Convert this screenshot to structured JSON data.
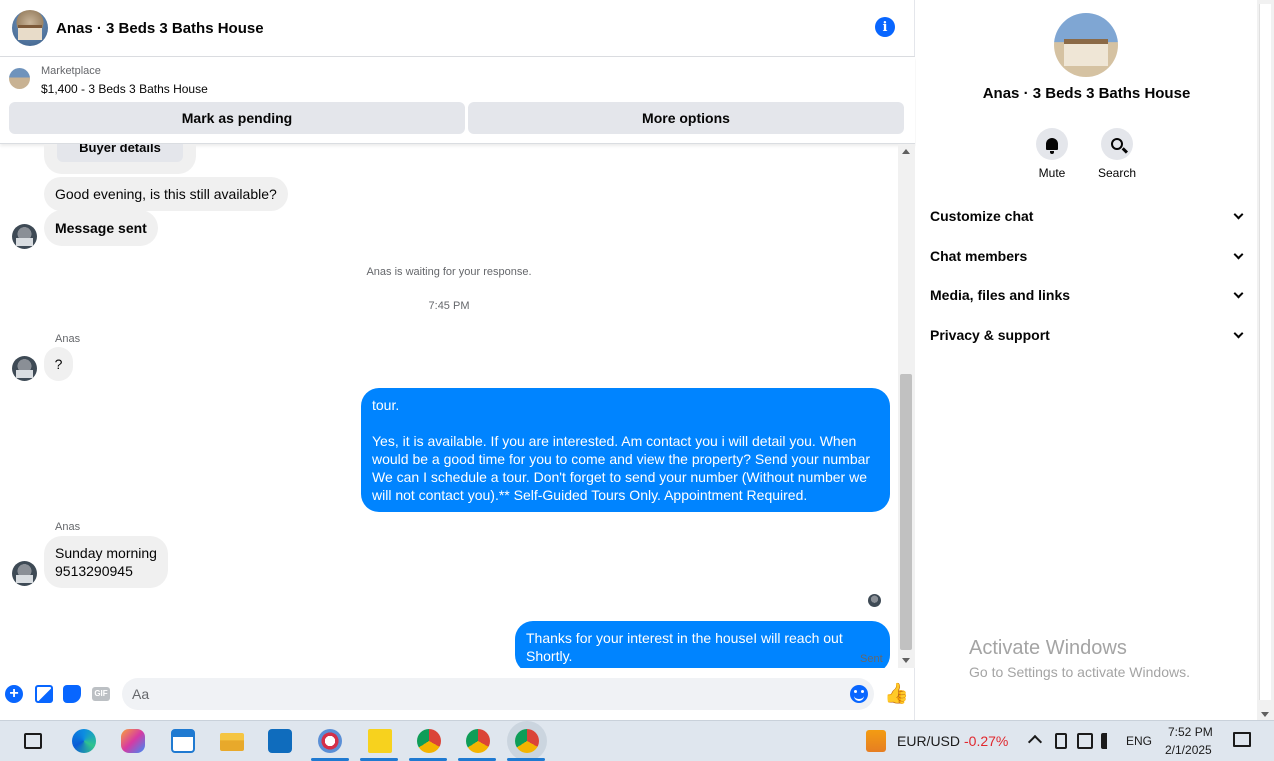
{
  "header": {
    "title": "Anas · 3 Beds 3 Baths House"
  },
  "marketplace": {
    "label": "Marketplace",
    "listing": "$1,400 - 3 Beds 3 Baths House",
    "pending_label": "Mark as pending",
    "more_label": "More options"
  },
  "messages": {
    "buyer_details": "Buyer details",
    "m1": "Good evening, is this still available?",
    "m2": "Message sent",
    "system": "Anas is waiting for your response.",
    "time": "7:45 PM",
    "sender1": "Anas",
    "m3": "?",
    "m4": "tour.\n\nYes, it is available. If you are interested.  Am contact you i will detail you.  When would be a good time for you to come and view the property? Send your numbar We can I schedule a tour.  Don't forget to send your number (Without number we will not contact you).** Self-Guided Tours Only. Appointment Required.",
    "sender2": "Anas",
    "m5": "Sunday morning\n9513290945",
    "m6": "Thanks for your interest in the houseI will reach out Shortly.",
    "sent": "Sent"
  },
  "composer": {
    "placeholder": "Aa",
    "gif": "GIF"
  },
  "info": {
    "name": "Anas · 3 Beds 3 Baths House",
    "mute": "Mute",
    "search": "Search",
    "sections": [
      "Customize chat",
      "Chat members",
      "Media, files and links",
      "Privacy & support"
    ]
  },
  "watermark": {
    "line1": "Activate Windows",
    "line2": "Go to Settings to activate Windows."
  },
  "taskbar": {
    "ticker": "EUR/USD",
    "change": "-0.27%",
    "lang": "ENG",
    "time": "7:52 PM",
    "date": "2/1/2025"
  },
  "colors": {
    "accent": "#0866ff",
    "outgoing": "#0084ff",
    "incoming": "#f0f0f0",
    "negative": "#e0282e"
  }
}
